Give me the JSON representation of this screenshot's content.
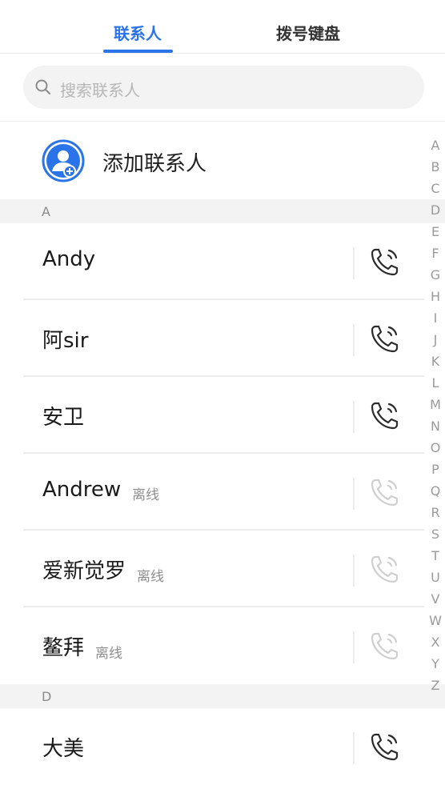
{
  "tabs": [
    {
      "label": "联系人",
      "active": true
    },
    {
      "label": "拨号键盘",
      "active": false
    }
  ],
  "search": {
    "placeholder": "搜索联系人",
    "icon": "search-icon"
  },
  "add_contact": {
    "label": "添加联系人",
    "icon": "add-contact-icon"
  },
  "sections": [
    {
      "letter": "A",
      "contacts": [
        {
          "name": "Andy",
          "status": "",
          "call_enabled": true
        },
        {
          "name": "阿sir",
          "status": "",
          "call_enabled": true
        },
        {
          "name": "安卫",
          "status": "",
          "call_enabled": true
        },
        {
          "name": "Andrew",
          "status": "离线",
          "call_enabled": false
        },
        {
          "name": "爱新觉罗",
          "status": "离线",
          "call_enabled": false
        },
        {
          "name": "鳌拜",
          "status": "离线",
          "call_enabled": false
        }
      ]
    },
    {
      "letter": "D",
      "contacts": [
        {
          "name": "大美",
          "status": "",
          "call_enabled": true
        }
      ]
    }
  ],
  "alphabet": [
    "A",
    "B",
    "C",
    "D",
    "E",
    "F",
    "G",
    "H",
    "I",
    "J",
    "K",
    "L",
    "M",
    "N",
    "O",
    "P",
    "Q",
    "R",
    "S",
    "T",
    "U",
    "V",
    "W",
    "X",
    "Y",
    "Z"
  ],
  "colors": {
    "accent": "#2a73e8",
    "icon_active": "#2b2b2b",
    "icon_disabled": "#cfcfcf",
    "status": "#8e8e8e"
  }
}
